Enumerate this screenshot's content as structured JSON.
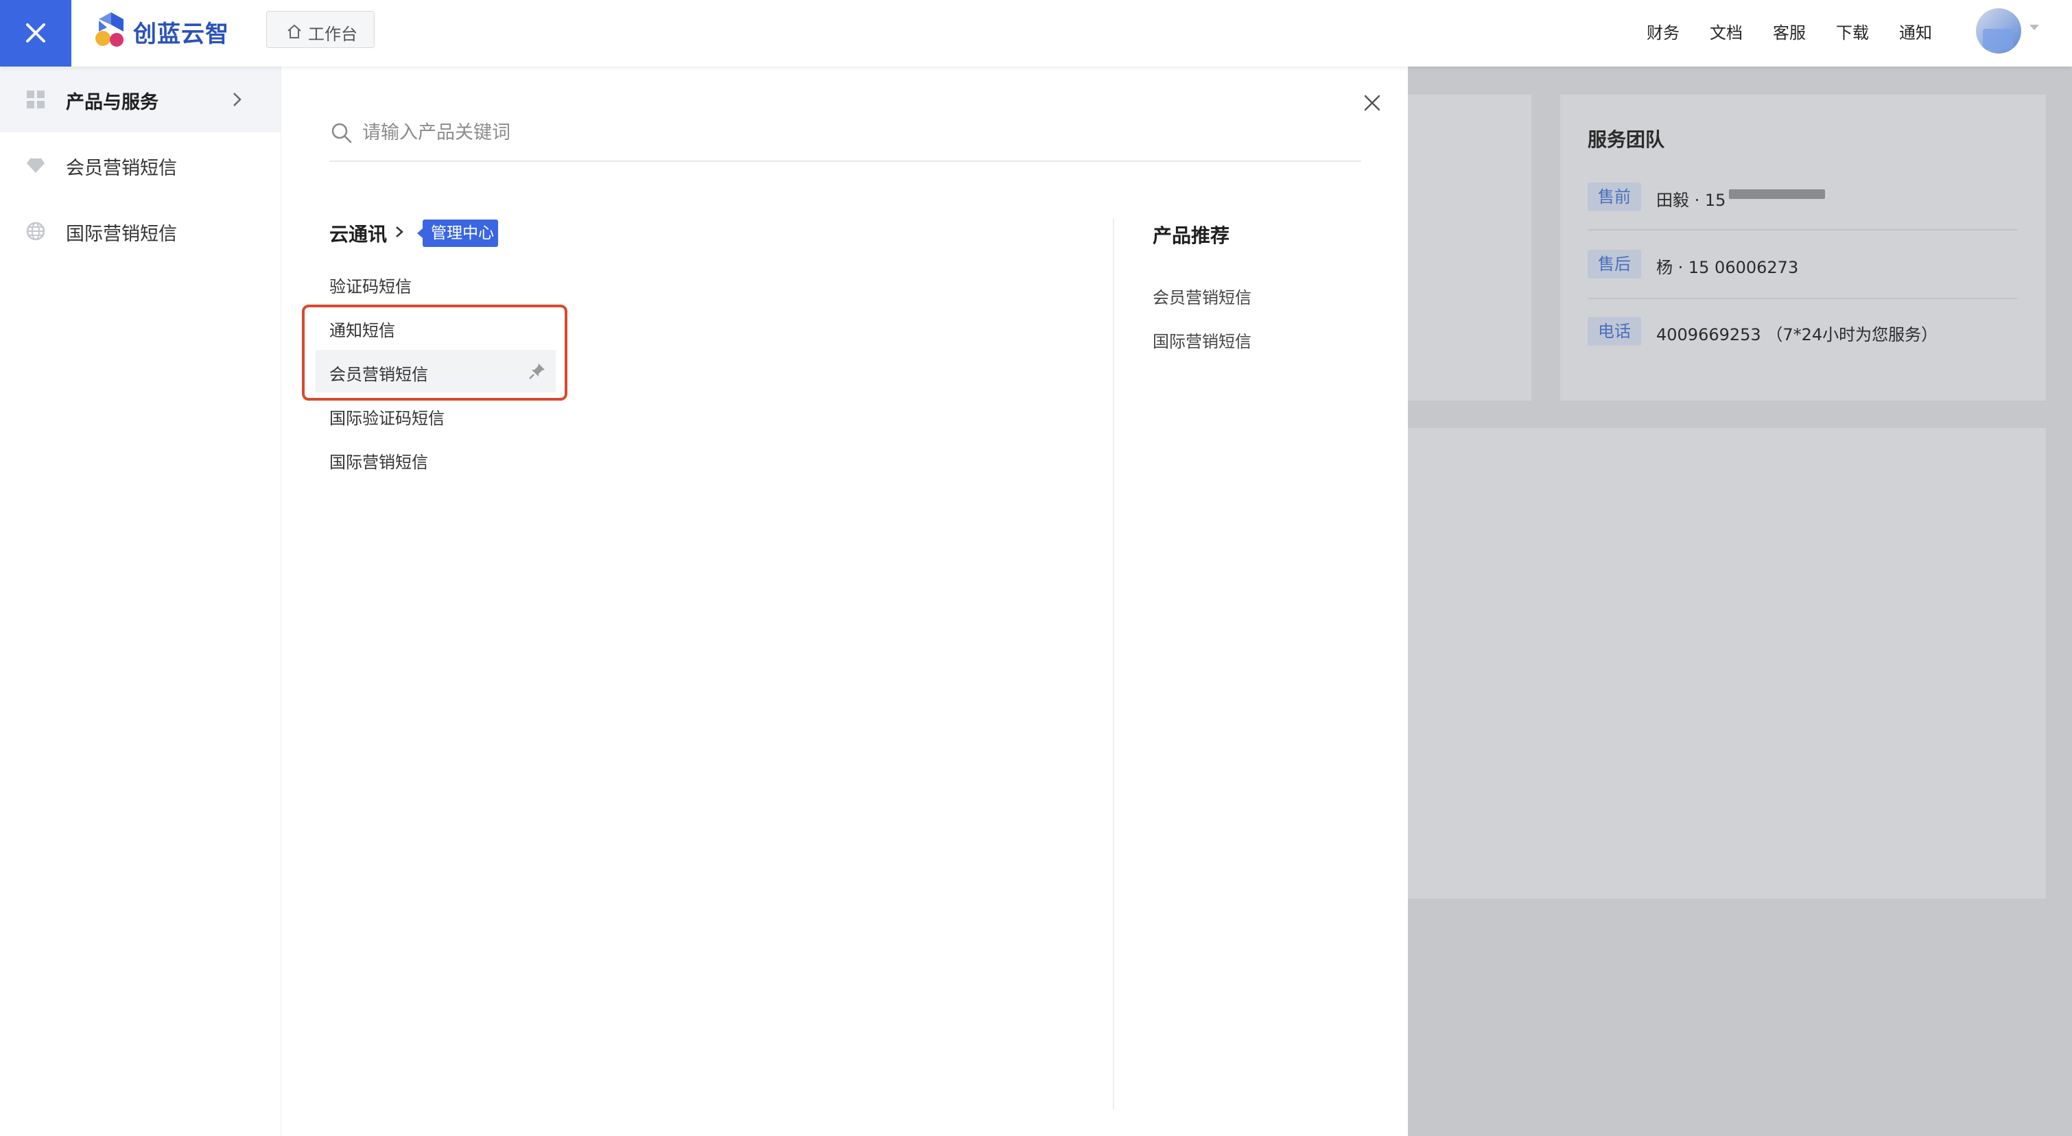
{
  "topbar": {
    "brand": "创蓝云智",
    "workbench_label": "工作台",
    "nav": [
      "财务",
      "文档",
      "客服",
      "下载",
      "通知"
    ]
  },
  "sidebar": {
    "items": [
      {
        "label": "产品与服务",
        "icon": "grid-icon",
        "active": true
      },
      {
        "label": "会员营销短信",
        "icon": "diamond-icon",
        "active": false
      },
      {
        "label": "国际营销短信",
        "icon": "globe-icon",
        "active": false
      }
    ]
  },
  "panel": {
    "search_placeholder": "请输入产品关键词",
    "category": {
      "title": "云通讯",
      "badge": "管理中心",
      "products": [
        "验证码短信",
        "通知短信",
        "会员营销短信",
        "国际验证码短信",
        "国际营销短信"
      ]
    },
    "recommend": {
      "title": "产品推荐",
      "items": [
        "会员营销短信",
        "国际营销短信"
      ]
    }
  },
  "service_team": {
    "title": "服务团队",
    "rows": [
      {
        "tag": "售前",
        "value": "田毅 · 15"
      },
      {
        "tag": "售后",
        "value": "杨 · 15  06006273"
      },
      {
        "tag": "电话",
        "value": "4009669253 （7*24小时为您服务）"
      }
    ]
  },
  "colors": {
    "accent": "#3a66e2",
    "highlight": "#d84a2e",
    "overlay": "#c6c7ca"
  }
}
